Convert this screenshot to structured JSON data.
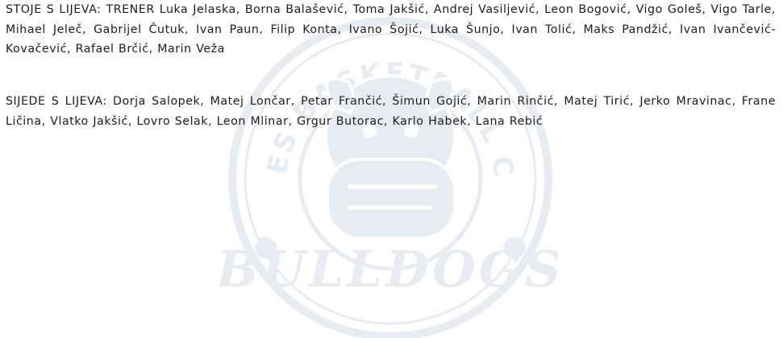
{
  "captions": {
    "standing": "STOJE S LIJEVA: TRENER Luka Jelaska, Borna Balašević, Toma Jakšić, Andrej Vasiljević, Leon Bogović, Vigo Goleš, Vigo Tarle, Mihael Jeleč, Gabrijel Čutuk, Ivan Paun, Filip Konta, Ivano Šojić, Luka Šunjo, Ivan Tolić, Maks Pandžić, Ivan Ivančević-Kovačević, Rafael Brčić, Marin Veža",
    "sitting": "SIJEDE S LIJEVA: Dorja Salopek, Matej Lončar, Petar Frančić, Šimun Gojić, Marin Rinčić, Matej Tirić, Jerko Mravinac, Frane Ličina, Vlatko Jakšić, Lovro Selak, Leon Mlinar, Grgur Butorac, Karlo Habek, Lana Rebić"
  },
  "watermark": {
    "ring_text": "ROSES BASKETBALL CLUB",
    "banner_text": "BULLDOGS",
    "color": "#6f8fb5",
    "icon": "bulldog-logo-icon"
  }
}
